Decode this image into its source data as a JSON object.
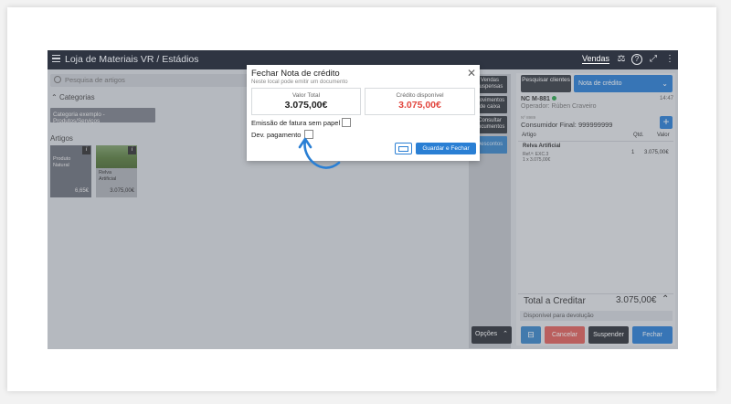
{
  "topbar": {
    "title": "Loja de Materiais VR",
    "separator": "/",
    "section": "Estádios",
    "mode_link": "Vendas"
  },
  "search": {
    "placeholder": "Pesquisa de artigos"
  },
  "categories": {
    "heading": "Categorias",
    "items": [
      "Categoria exemplo - Produtos/Serviços"
    ]
  },
  "articles": {
    "heading": "Artigos",
    "items": [
      {
        "name": "Produto Natural",
        "price": "6,65€"
      },
      {
        "name": "Relva Artificial",
        "price": "3.075,00€"
      }
    ]
  },
  "middle_buttons": [
    "Vendas suspensas",
    "Movimentos de caixa",
    "Consultar documentos",
    "Descontos"
  ],
  "options_button": "Opções",
  "right": {
    "search_clients": "Pesquisar clientes",
    "doc_type": "Nota de crédito",
    "doc_number": "NC M-881",
    "time": "14:47",
    "operator": "Operador: Rúben Craveiro",
    "nif_label": "Nº 8989",
    "customer": "Consumidor Final: 999999999",
    "columns": {
      "article": "Artigo",
      "qty": "Qtd.",
      "value": "Valor"
    },
    "lines": [
      {
        "name": "Relva Artificial",
        "ref": "Ref.ª: EXC.3",
        "detail": "1 x 3.075,00€",
        "qty": "1",
        "value": "3.075,00€"
      }
    ],
    "total_label": "Total a Creditar",
    "total_value": "3.075,00€",
    "available": "Disponível para devolução",
    "buttons": {
      "cancel": "Cancelar",
      "suspend": "Suspender",
      "close": "Fechar"
    }
  },
  "modal": {
    "title": "Fechar Nota de crédito",
    "subtitle": "Neste local pode emitir um documento",
    "total_label": "Valor Total",
    "total_value": "3.075,00€",
    "credit_label": "Crédito disponível",
    "credit_value": "3.075,00€",
    "paperless_label": "Emissão de fatura sem papel",
    "refund_label": "Dev. pagamento",
    "save_button": "Guardar e Fechar"
  },
  "colors": {
    "accent": "#2a7fd4",
    "credit_red": "#e2463e",
    "cancel_red": "#e0605a",
    "topbar": "#2f3542"
  }
}
